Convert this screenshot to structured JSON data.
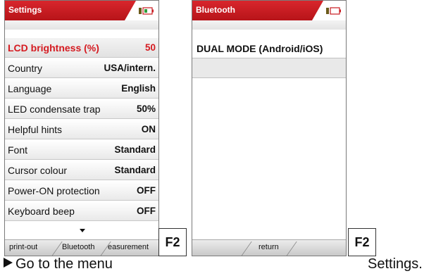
{
  "settings_screen": {
    "title": "Settings",
    "rows": [
      {
        "label": "LCD brightness (%)",
        "value": "50",
        "selected": true
      },
      {
        "label": "Country",
        "value": "USA/intern."
      },
      {
        "label": "Language",
        "value": "English"
      },
      {
        "label": "LED condensate trap",
        "value": "50%"
      },
      {
        "label": "Helpful hints",
        "value": "ON"
      },
      {
        "label": "Font",
        "value": "Standard"
      },
      {
        "label": "Cursor colour",
        "value": "Standard"
      },
      {
        "label": "Power-ON protection",
        "value": "OFF"
      },
      {
        "label": "Keyboard beep",
        "value": "OFF"
      }
    ],
    "softkeys": [
      "print-out",
      "Bluetooth",
      "easurement"
    ]
  },
  "bluetooth_screen": {
    "title": "Bluetooth",
    "item": "DUAL MODE (Android/iOS)",
    "softkey": "return"
  },
  "function_keys": {
    "left": "F2",
    "right": "F2"
  },
  "caption": {
    "left": "Go to the menu",
    "right": "Settings."
  },
  "colors": {
    "accent_red": "#c81a20",
    "selected_text": "#d51a20"
  },
  "icons": {
    "status": "battery-icon",
    "more": "triangle-down-icon",
    "arrow": "triangle-right-icon"
  }
}
